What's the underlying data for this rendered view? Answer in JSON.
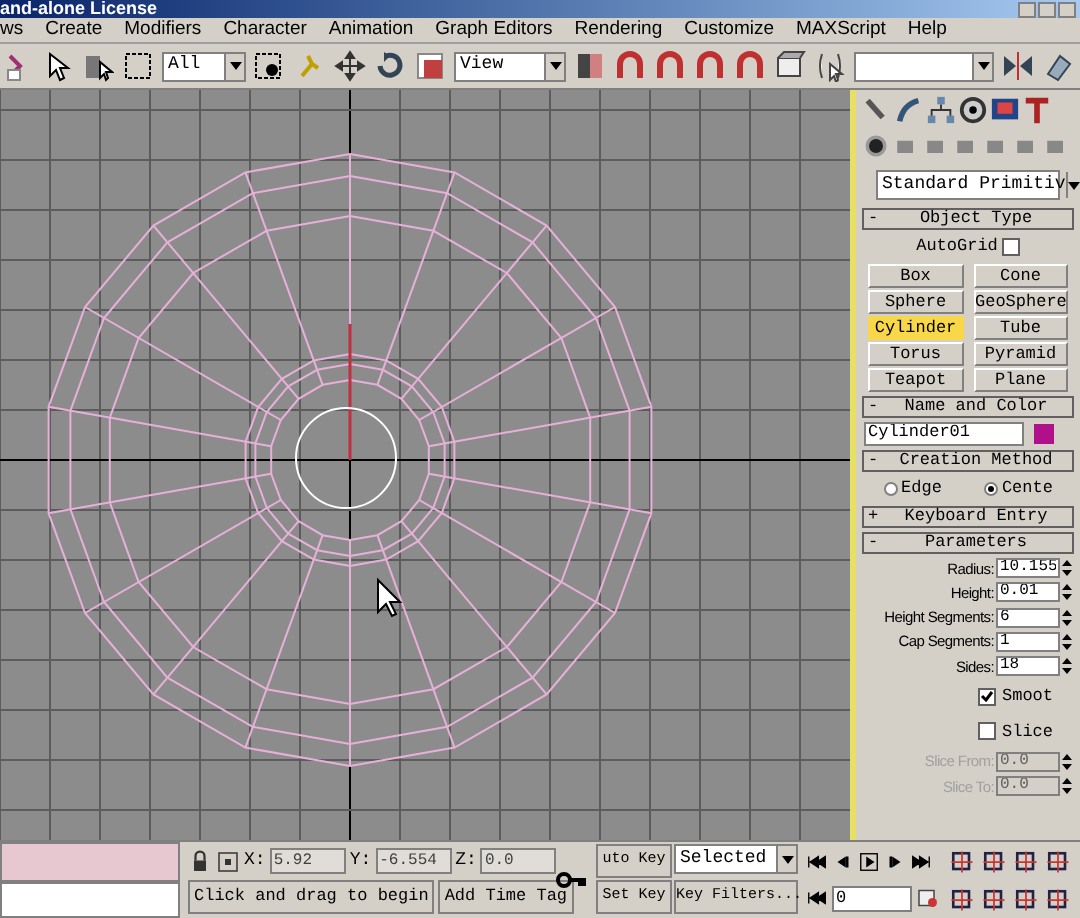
{
  "window": {
    "title": "and-alone License"
  },
  "menu": [
    "ws",
    "Create",
    "Modifiers",
    "Character",
    "Animation",
    "Graph Editors",
    "Rendering",
    "Customize",
    "MAXScript",
    "Help"
  ],
  "toolbar": {
    "selection_filter": "All",
    "reference_coord": "View"
  },
  "command_panel": {
    "category": "Standard Primitiv",
    "object_type": {
      "toggle": "-",
      "title": "Object Type",
      "autogrid": {
        "label": "AutoGrid",
        "checked": false
      },
      "buttons": [
        {
          "label": "Box",
          "selected": false
        },
        {
          "label": "Cone",
          "selected": false
        },
        {
          "label": "Sphere",
          "selected": false
        },
        {
          "label": "GeoSphere",
          "selected": false
        },
        {
          "label": "Cylinder",
          "selected": true
        },
        {
          "label": "Tube",
          "selected": false
        },
        {
          "label": "Torus",
          "selected": false
        },
        {
          "label": "Pyramid",
          "selected": false
        },
        {
          "label": "Teapot",
          "selected": false
        },
        {
          "label": "Plane",
          "selected": false
        }
      ]
    },
    "name_and_color": {
      "toggle": "-",
      "title": "Name and Color",
      "name": "Cylinder01",
      "color": "#b0108a"
    },
    "creation_method": {
      "toggle": "-",
      "title": "Creation Method",
      "options": [
        {
          "label": "Edge",
          "selected": false
        },
        {
          "label": "Cente",
          "selected": true
        }
      ]
    },
    "keyboard_entry": {
      "toggle": "+",
      "title": "Keyboard Entry"
    },
    "parameters": {
      "toggle": "-",
      "title": "Parameters",
      "items": [
        {
          "kind": "spinner",
          "label": "Radius:",
          "value": "10.155",
          "disabled": false
        },
        {
          "kind": "spinner",
          "label": "Height:",
          "value": "0.01",
          "disabled": false
        },
        {
          "kind": "spinner",
          "label": "Height Segments:",
          "value": "6",
          "disabled": false
        },
        {
          "kind": "spinner",
          "label": "Cap Segments:",
          "value": "1",
          "disabled": false
        },
        {
          "kind": "spinner",
          "label": "Sides:",
          "value": "18",
          "disabled": false
        },
        {
          "kind": "checkbox",
          "label": "Smoot",
          "checked": true
        },
        {
          "kind": "checkbox",
          "label": "Slice",
          "checked": false
        },
        {
          "kind": "spinner",
          "label": "Slice From:",
          "value": "0.0",
          "disabled": true
        },
        {
          "kind": "spinner",
          "label": "Slice To:",
          "value": "0.0",
          "disabled": true
        }
      ]
    }
  },
  "status": {
    "coords": [
      {
        "label": "X:",
        "value": "5.92"
      },
      {
        "label": "Y:",
        "value": "-6.554"
      },
      {
        "label": "Z:",
        "value": "0.0"
      }
    ],
    "prompt": "Click and drag to begin",
    "time_tag": "Add Time Tag",
    "auto_key": "uto Key",
    "set_key": "Set Key",
    "key_mode": "Selected",
    "key_filters": "Key Filters...",
    "frame": "0"
  }
}
